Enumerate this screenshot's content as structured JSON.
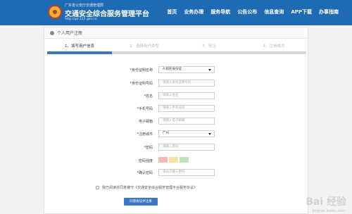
{
  "header": {
    "subtitle": "广东省公安厅交通管理局",
    "title": "交通安全综合服务管理平台",
    "url": "http://gd.122.gov.cn",
    "nav": [
      "首页",
      "业务办理",
      "服务导航",
      "公告公布",
      "信息查询",
      "APP下载",
      "办事指南"
    ]
  },
  "panel": {
    "heading": "个人用户注册"
  },
  "steps": [
    {
      "label": "1、填写用户信息",
      "active": true
    },
    {
      "label": "2、选择用户类型",
      "active": false
    },
    {
      "label": "3、验证",
      "active": false
    },
    {
      "label": "4、注册成功",
      "active": false
    }
  ],
  "form": {
    "id_type": {
      "label": "*身份证明名称",
      "value": "A:居民身份证"
    },
    "id_number": {
      "label": "*身份证明号码",
      "placeholder": "请输入身份证明号码"
    },
    "name": {
      "label": "*姓名",
      "placeholder": "请输入姓名"
    },
    "phone": {
      "label": "*手机号码",
      "placeholder": "请输入手机号码"
    },
    "email": {
      "label": "电子邮箱",
      "placeholder": "请输入电子邮箱"
    },
    "city": {
      "label": "*注册城市",
      "value": "广州"
    },
    "password": {
      "label": "*密码",
      "placeholder": "请输入密码"
    },
    "strength": {
      "label": "密码强度",
      "colors": [
        "#f4b9ae",
        "#f6e2a6",
        "#bfe3b4"
      ]
    },
    "confirm": {
      "label": "*确认密码",
      "placeholder": "请再次输入密码"
    }
  },
  "agree": {
    "text": "我已阅读并同意遵守《交通安全综合服务管理平台服务协议》"
  },
  "submit": {
    "label": "同意协议并注册"
  },
  "watermark": {
    "text": "Bai 经验",
    "sub": "jingyan.baidu.com"
  }
}
